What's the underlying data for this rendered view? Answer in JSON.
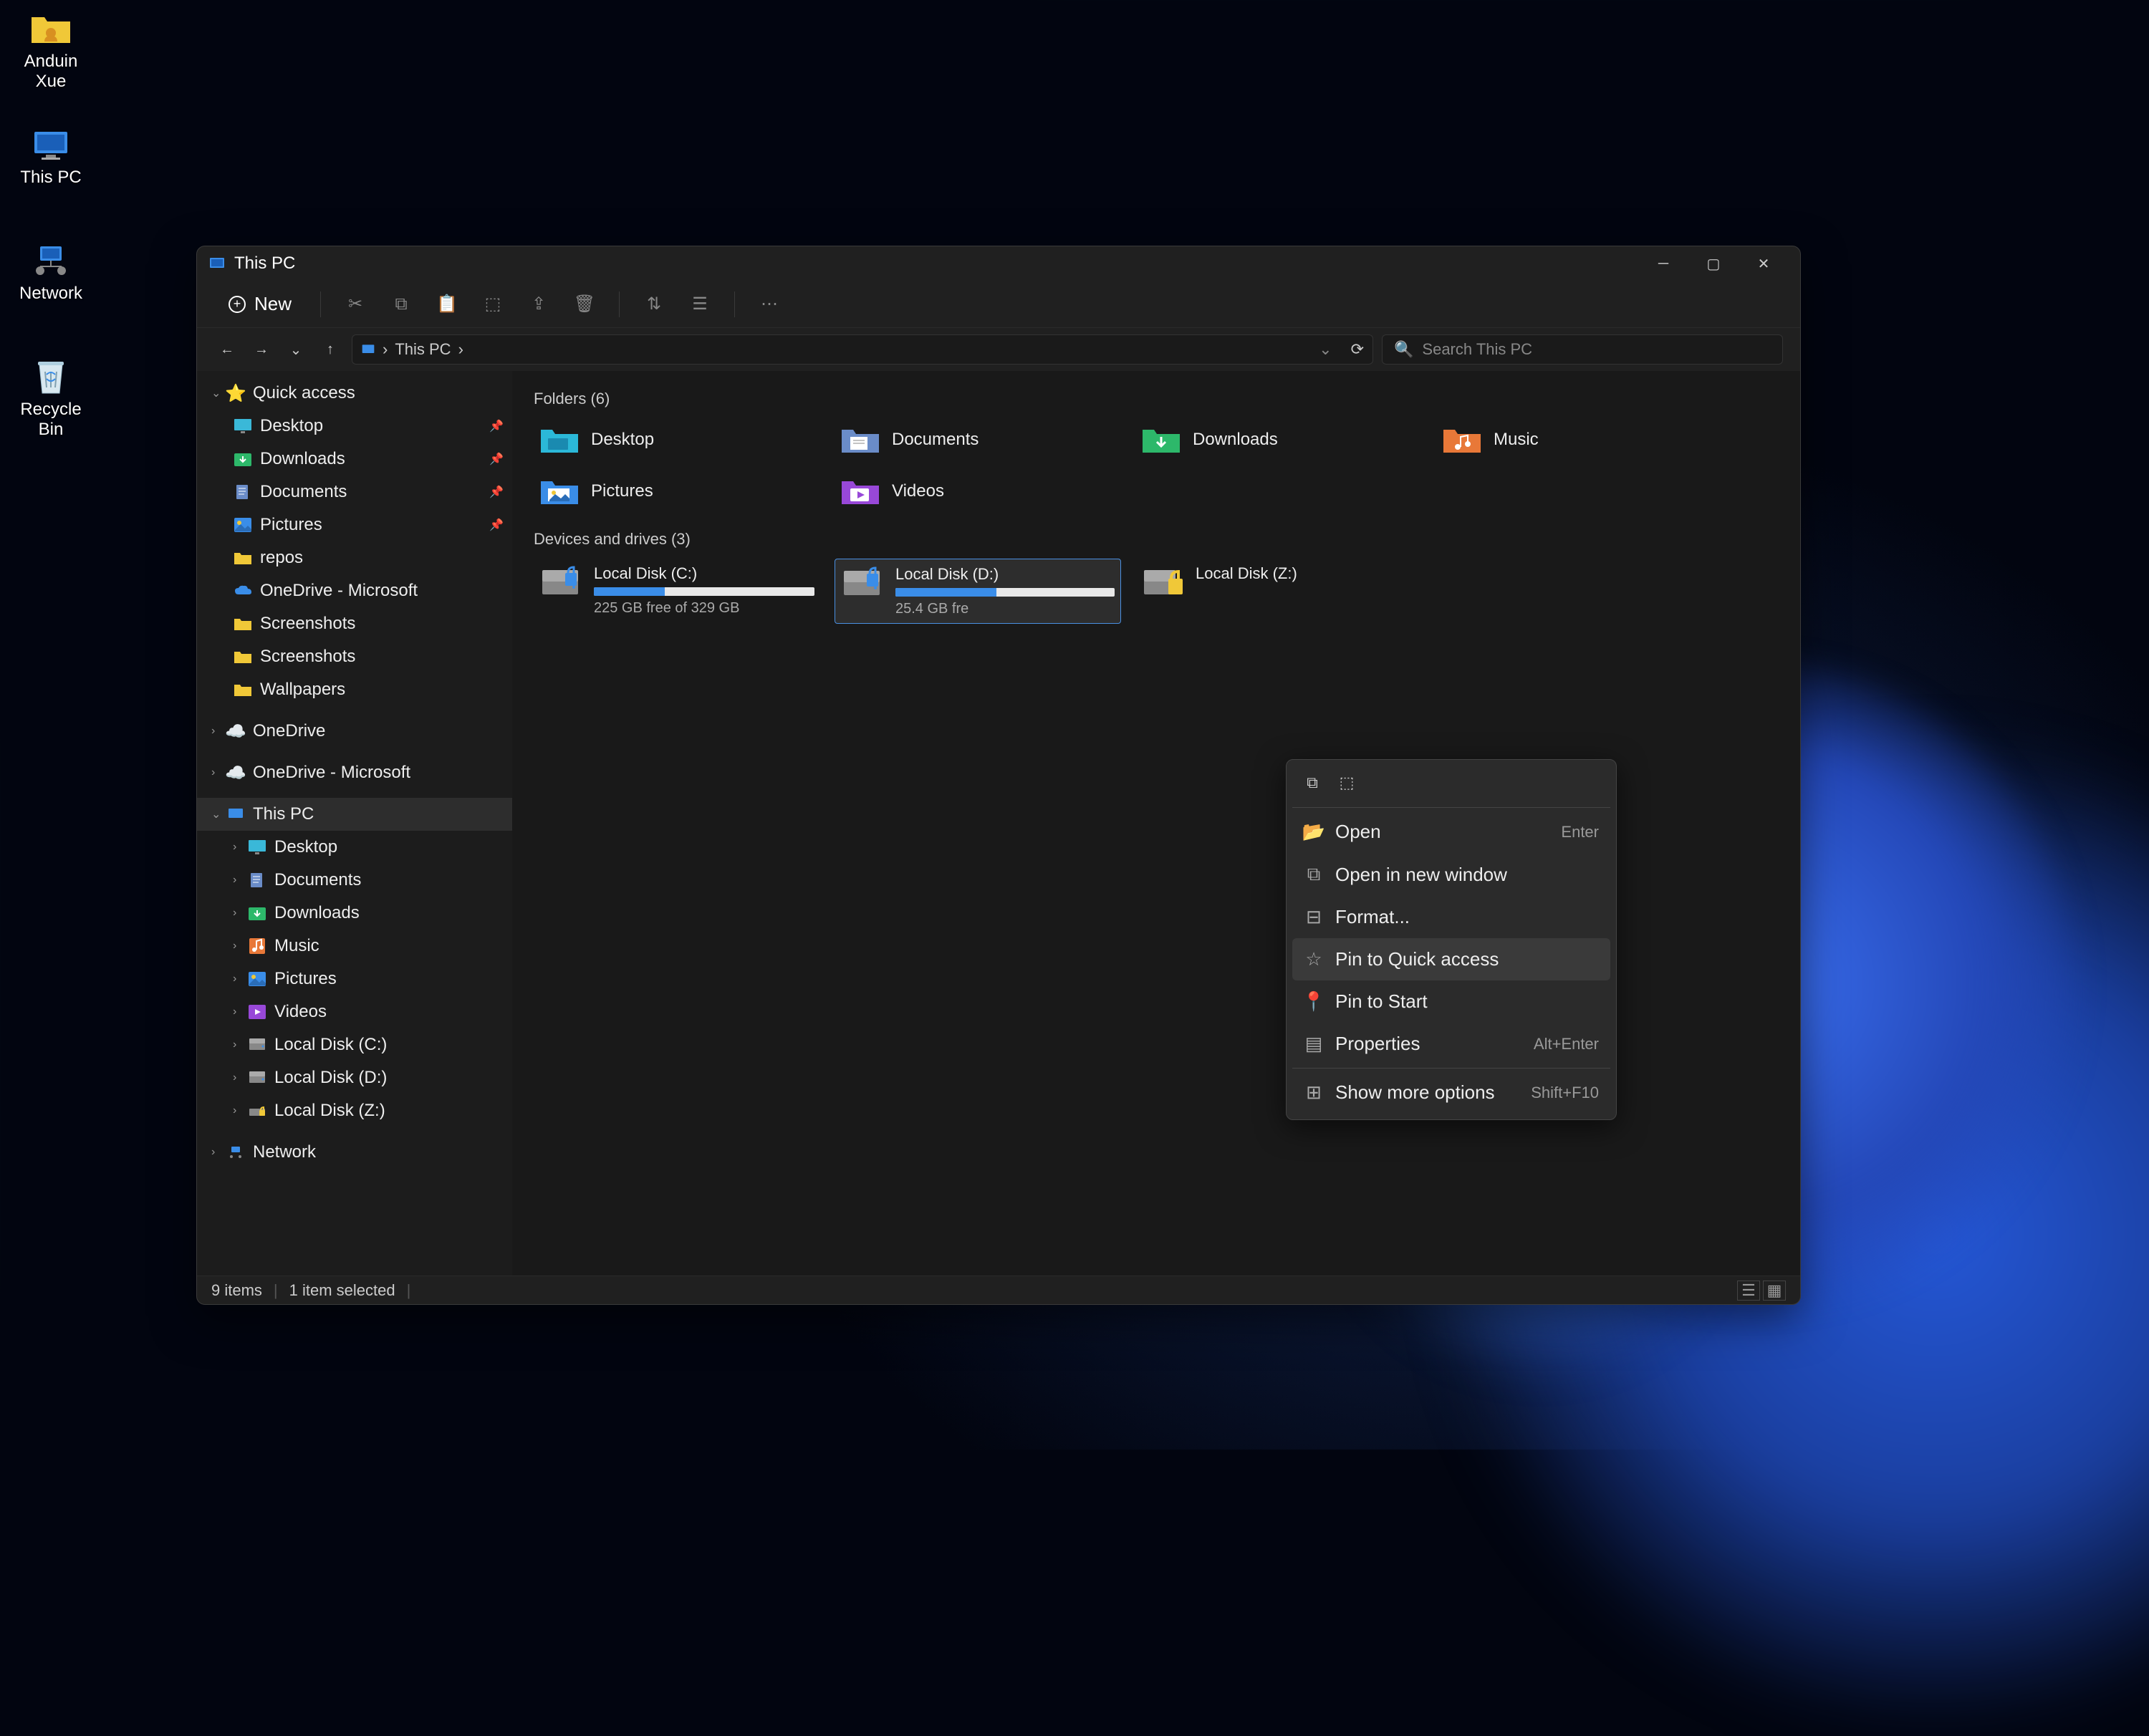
{
  "desktop_icons": [
    {
      "label": "Anduin Xue",
      "type": "user-folder"
    },
    {
      "label": "This PC",
      "type": "this-pc"
    },
    {
      "label": "Network",
      "type": "network"
    },
    {
      "label": "Recycle Bin",
      "type": "recycle-bin"
    }
  ],
  "window": {
    "title": "This PC"
  },
  "toolbar": {
    "new_label": "New"
  },
  "address": {
    "path": "This PC",
    "separator": "›"
  },
  "search": {
    "placeholder": "Search This PC"
  },
  "sidebar": {
    "quick_access": {
      "label": "Quick access",
      "items": [
        {
          "label": "Desktop",
          "pinned": true,
          "icon": "desktop"
        },
        {
          "label": "Downloads",
          "pinned": true,
          "icon": "downloads"
        },
        {
          "label": "Documents",
          "pinned": true,
          "icon": "documents"
        },
        {
          "label": "Pictures",
          "pinned": true,
          "icon": "pictures"
        },
        {
          "label": "repos",
          "pinned": false,
          "icon": "folder"
        },
        {
          "label": "OneDrive - Microsoft",
          "pinned": false,
          "icon": "onedrive"
        },
        {
          "label": "Screenshots",
          "pinned": false,
          "icon": "folder"
        },
        {
          "label": "Screenshots",
          "pinned": false,
          "icon": "folder"
        },
        {
          "label": "Wallpapers",
          "pinned": false,
          "icon": "folder"
        }
      ]
    },
    "onedrive": {
      "label": "OneDrive"
    },
    "onedrive_ms": {
      "label": "OneDrive - Microsoft"
    },
    "this_pc": {
      "label": "This PC",
      "items": [
        {
          "label": "Desktop",
          "icon": "desktop"
        },
        {
          "label": "Documents",
          "icon": "documents"
        },
        {
          "label": "Downloads",
          "icon": "downloads"
        },
        {
          "label": "Music",
          "icon": "music"
        },
        {
          "label": "Pictures",
          "icon": "pictures"
        },
        {
          "label": "Videos",
          "icon": "videos"
        },
        {
          "label": "Local Disk (C:)",
          "icon": "disk"
        },
        {
          "label": "Local Disk (D:)",
          "icon": "disk"
        },
        {
          "label": "Local Disk (Z:)",
          "icon": "disk-locked"
        }
      ]
    },
    "network": {
      "label": "Network"
    }
  },
  "content": {
    "folders_header": "Folders (6)",
    "folders": [
      {
        "name": "Desktop",
        "color": "#2bb8d8"
      },
      {
        "name": "Documents",
        "color": "#6a8cc8"
      },
      {
        "name": "Downloads",
        "color": "#2db86a"
      },
      {
        "name": "Music",
        "color": "#e87838"
      },
      {
        "name": "Pictures",
        "color": "#3a8de8"
      },
      {
        "name": "Videos",
        "color": "#9848d8"
      }
    ],
    "drives_header": "Devices and drives (3)",
    "drives": [
      {
        "name": "Local Disk (C:)",
        "free_text": "225 GB free of 329 GB",
        "fill_percent": 32,
        "selected": false,
        "locked": false
      },
      {
        "name": "Local Disk (D:)",
        "free_text": "25.4 GB fre",
        "fill_percent": 46,
        "selected": true,
        "locked": false
      },
      {
        "name": "Local Disk (Z:)",
        "free_text": "",
        "fill_percent": 0,
        "selected": false,
        "locked": true,
        "no_bar": true
      }
    ]
  },
  "context_menu": {
    "items": [
      {
        "label": "Open",
        "shortcut": "Enter",
        "icon": "folder-open"
      },
      {
        "label": "Open in new window",
        "shortcut": "",
        "icon": "new-window"
      },
      {
        "label": "Format...",
        "shortcut": "",
        "icon": "format"
      },
      {
        "label": "Pin to Quick access",
        "shortcut": "",
        "icon": "star",
        "highlighted": true
      },
      {
        "label": "Pin to Start",
        "shortcut": "",
        "icon": "pin"
      },
      {
        "label": "Properties",
        "shortcut": "Alt+Enter",
        "icon": "properties"
      },
      {
        "label": "Show more options",
        "shortcut": "Shift+F10",
        "icon": "more"
      }
    ]
  },
  "statusbar": {
    "items_text": "9 items",
    "selected_text": "1 item selected"
  }
}
